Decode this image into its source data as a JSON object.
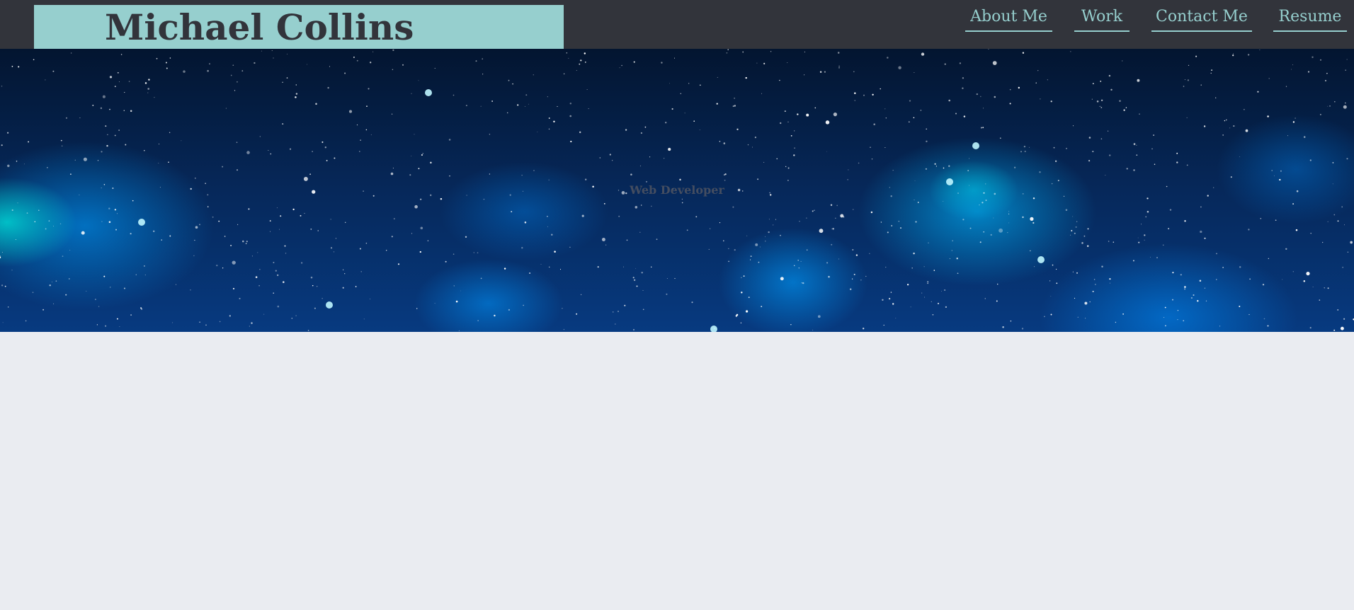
{
  "header": {
    "name": "Michael Collins",
    "nav": [
      {
        "label": "About Me"
      },
      {
        "label": "Work"
      },
      {
        "label": "Contact Me"
      },
      {
        "label": "Resume"
      }
    ]
  },
  "hero": {
    "tagline": "Web Developer",
    "background": "starry-space-nebula"
  },
  "colors": {
    "topbar": "#32343b",
    "accent": "#96cfce",
    "page_background": "#eaecf1",
    "tagline": "#4b5261"
  }
}
